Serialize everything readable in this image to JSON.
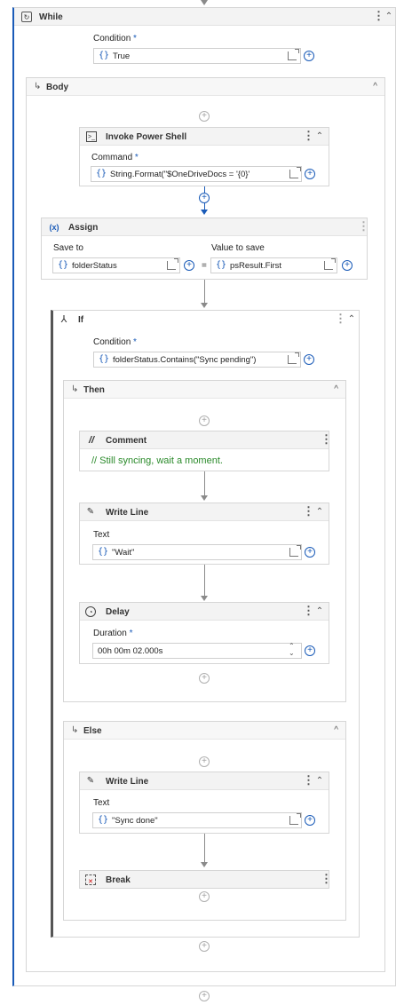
{
  "while": {
    "title": "While",
    "condition_label": "Condition",
    "required_mark": "*",
    "condition_value": "True"
  },
  "body": {
    "title": "Body"
  },
  "invoke_power_shell": {
    "title": "Invoke Power Shell",
    "command_label": "Command",
    "command_value": "String.Format(\"$OneDriveDocs = '{0}'"
  },
  "assign": {
    "icon": "(x)",
    "title": "Assign",
    "save_to_label": "Save to",
    "value_to_save_label": "Value to save",
    "save_to_value": "folderStatus",
    "equals": "=",
    "value_to_save": "psResult.First"
  },
  "if": {
    "title": "If",
    "condition_label": "Condition",
    "condition_value": "folderStatus.Contains(\"Sync pending\")"
  },
  "then": {
    "title": "Then"
  },
  "comment": {
    "title": "Comment",
    "text": "// Still syncing, wait a moment."
  },
  "write_line_1": {
    "title": "Write Line",
    "text_label": "Text",
    "text_value": "\"Wait\""
  },
  "delay": {
    "title": "Delay",
    "duration_label": "Duration",
    "duration_value": "00h 00m 02.000s"
  },
  "else": {
    "title": "Else"
  },
  "write_line_2": {
    "title": "Write Line",
    "text_label": "Text",
    "text_value": "\"Sync done\""
  },
  "break": {
    "title": "Break"
  },
  "icons": {
    "kebab": "⋮",
    "collapse": "⌃",
    "caret_up": "^",
    "plus": "+",
    "brace": "{}"
  }
}
